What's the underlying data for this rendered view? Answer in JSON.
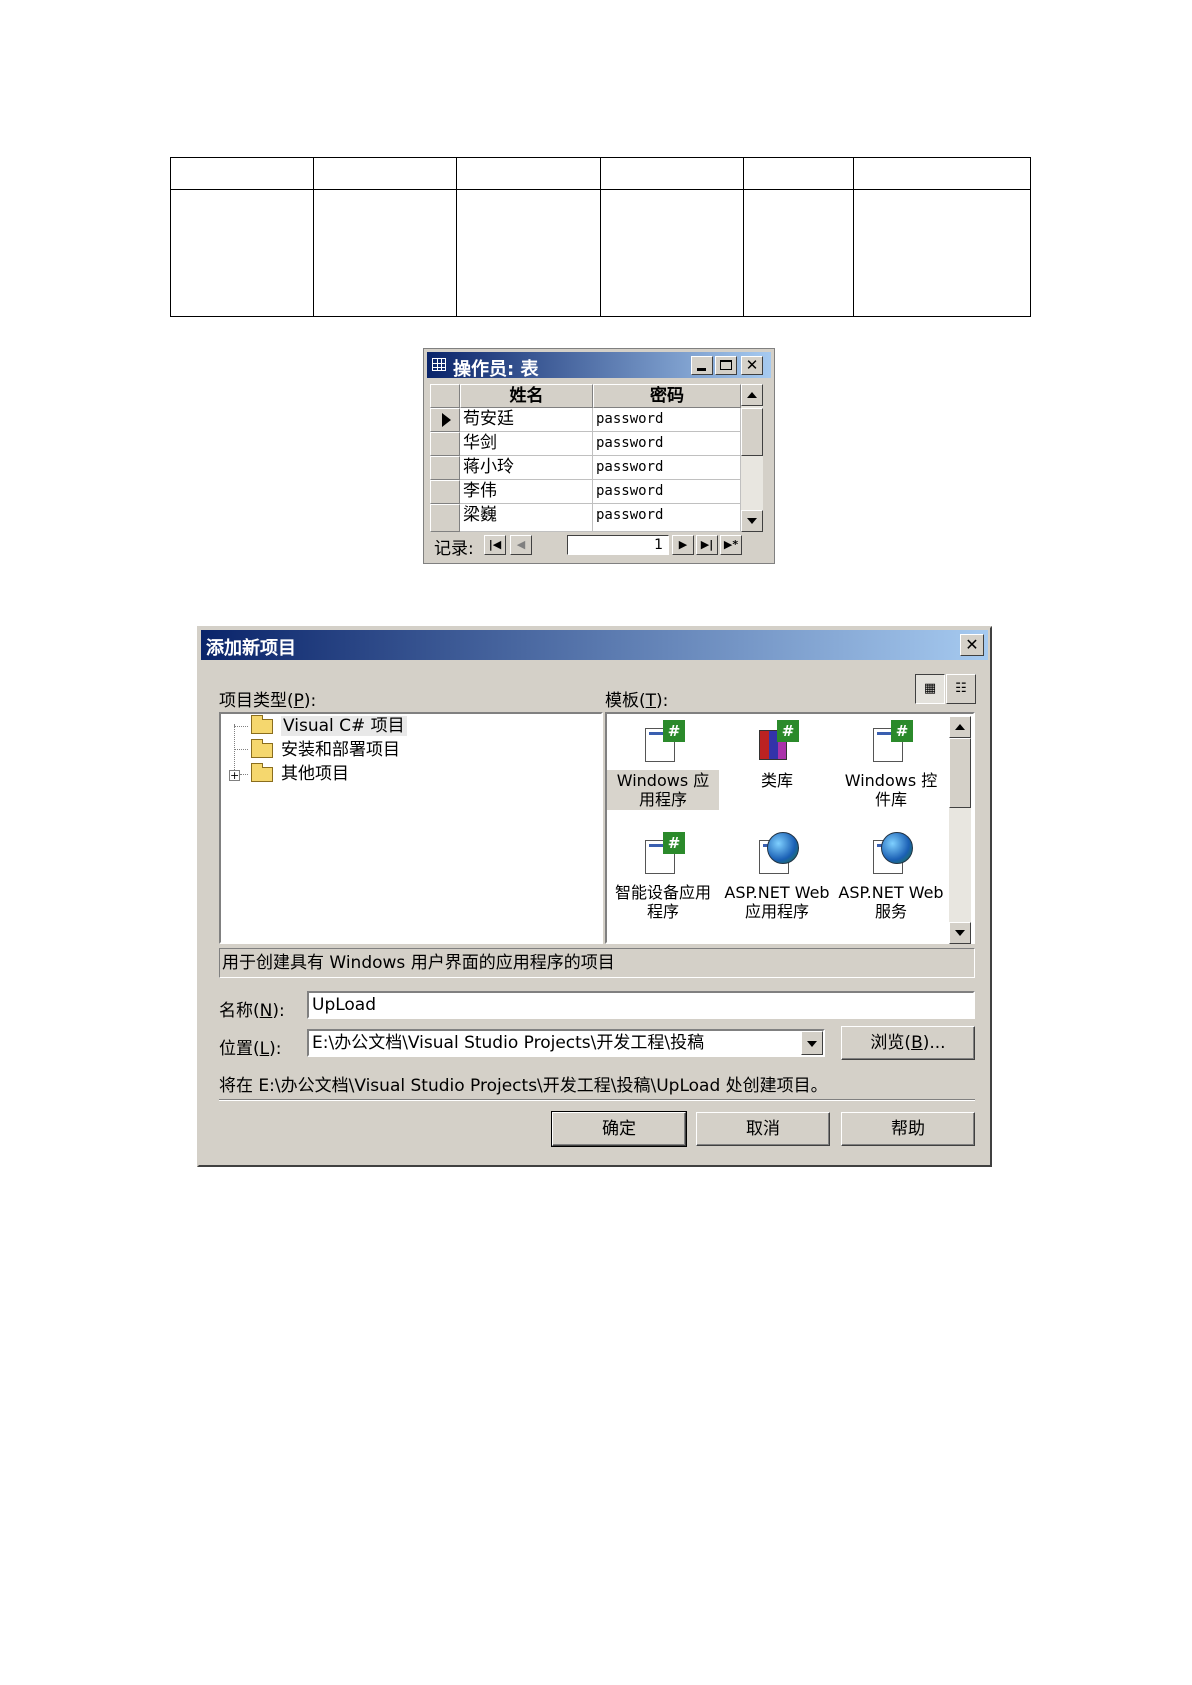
{
  "datasheet": {
    "title": "操作员: 表",
    "columns": [
      "姓名",
      "密码"
    ],
    "rows": [
      {
        "name": "苟安廷",
        "password": "password"
      },
      {
        "name": "华剑",
        "password": "password"
      },
      {
        "name": "蒋小玲",
        "password": "password"
      },
      {
        "name": "李伟",
        "password": "password"
      },
      {
        "name": "梁巍",
        "password": "password"
      }
    ],
    "nav": {
      "label": "记录:",
      "record_number": "1"
    }
  },
  "dialog": {
    "title": "添加新项目",
    "close_glyph": "✕",
    "project_types_label_prefix": "项目类型(",
    "project_types_label_key": "P",
    "project_types_label_suffix": "):",
    "templates_label_prefix": "模板(",
    "templates_label_key": "T",
    "templates_label_suffix": "):",
    "project_types": [
      {
        "label": "Visual C# 项目",
        "selected": true,
        "icon": "open-folder-icon"
      },
      {
        "label": "安装和部署项目",
        "selected": false,
        "icon": "folder-icon"
      },
      {
        "label": "其他项目",
        "selected": false,
        "icon": "folder-icon",
        "expandable": true
      }
    ],
    "templates": [
      {
        "label": "Windows 应用程序",
        "icon": "windows-app-icon",
        "selected": true
      },
      {
        "label": "类库",
        "icon": "class-library-icon",
        "selected": false
      },
      {
        "label": "Windows 控件库",
        "icon": "control-library-icon",
        "selected": false
      },
      {
        "label": "智能设备应用程序",
        "icon": "smart-device-icon",
        "selected": false
      },
      {
        "label": "ASP.NET Web 应用程序",
        "icon": "web-app-icon",
        "selected": false
      },
      {
        "label": "ASP.NET Web 服务",
        "icon": "web-service-icon",
        "selected": false
      }
    ],
    "description": "用于创建具有 Windows 用户界面的应用程序的项目",
    "name_label_prefix": "名称(",
    "name_label_key": "N",
    "name_label_suffix": "):",
    "name_value": "UpLoad",
    "location_label_prefix": "位置(",
    "location_label_key": "L",
    "location_label_suffix": "):",
    "location_value": "E:\\办公文档\\Visual Studio Projects\\开发工程\\投稿",
    "browse_prefix": "浏览(",
    "browse_key": "B",
    "browse_suffix": ")...",
    "create_info": "将在 E:\\办公文档\\Visual Studio Projects\\开发工程\\投稿\\UpLoad 处创建项目。",
    "buttons": {
      "ok": "确定",
      "cancel": "取消",
      "help": "帮助"
    }
  }
}
